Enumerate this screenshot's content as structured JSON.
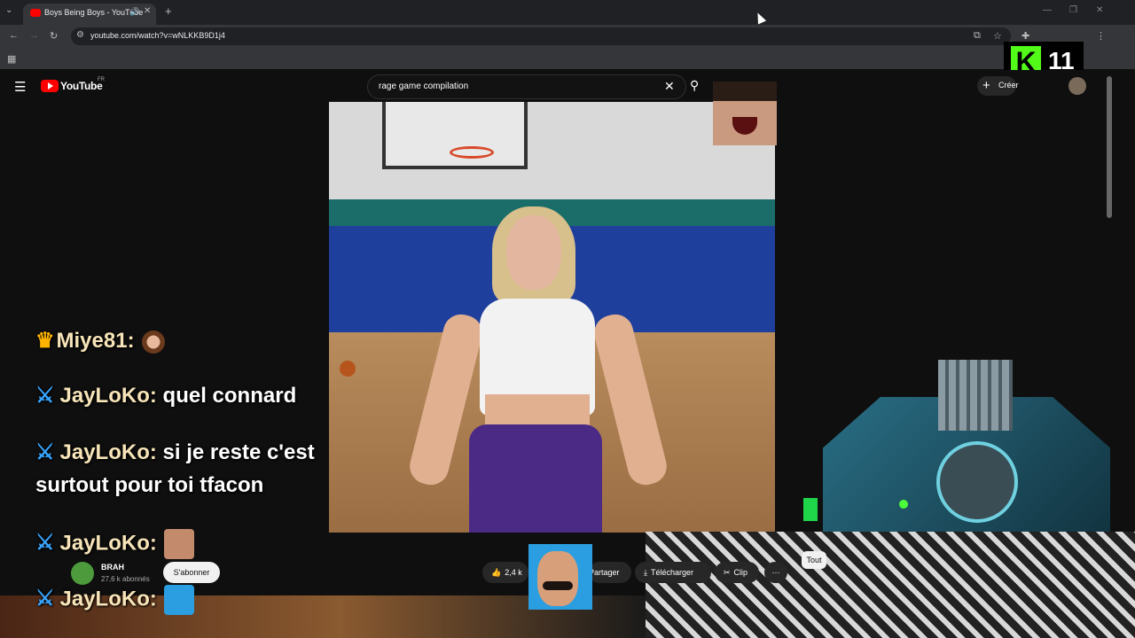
{
  "browser": {
    "tab_title": "Boys Being Boys - YouTube",
    "url": "youtube.com/watch?v=wNLKKB9D1j4",
    "icons": [
      "tab-list-icon",
      "speaker-icon",
      "close-icon",
      "new-tab-icon",
      "back-icon",
      "forward-icon",
      "reload-icon",
      "site-settings-icon",
      "install-icon",
      "star-icon",
      "extensions-icon",
      "media-icon",
      "profile-icon",
      "kebab-menu-icon",
      "apps-grid-icon"
    ]
  },
  "youtube": {
    "logo_text": "YouTube",
    "region": "FR",
    "search_value": "rage game compilation",
    "create_label": "Créer",
    "channel": {
      "name": "BRAH",
      "subscribers": "27,6 k abonnés"
    },
    "subscribe_label": "S'abonner",
    "actions": {
      "likes": "2,4 k",
      "share": "Partager",
      "download": "Télécharger",
      "clip": "Clip",
      "more": "⋯"
    },
    "filter_chip": "Tout"
  },
  "kick_badge": {
    "number": "11",
    "logo_letter": "K",
    "brand_color": "#53fc18"
  },
  "chat": [
    {
      "user": "Miye81",
      "separator": ":",
      "message": "",
      "badge": "crown"
    },
    {
      "user": "JayLoKo",
      "separator": ":",
      "message": "quel connard",
      "badge": "sword"
    },
    {
      "user": "JayLoKo",
      "separator": ":",
      "message": "si je reste c'est",
      "message_line2": "surtout pour toi tfacon",
      "badge": "sword"
    },
    {
      "user": "JayLoKo",
      "separator": ":",
      "message": "",
      "badge": "sword"
    },
    {
      "user": "JayLoKo",
      "separator": ":",
      "message": "",
      "badge": "sword"
    }
  ],
  "colors": {
    "yt_red": "#ff0000",
    "chat_user": "#f7e4b8",
    "badge_blue": "#37a5ff"
  }
}
